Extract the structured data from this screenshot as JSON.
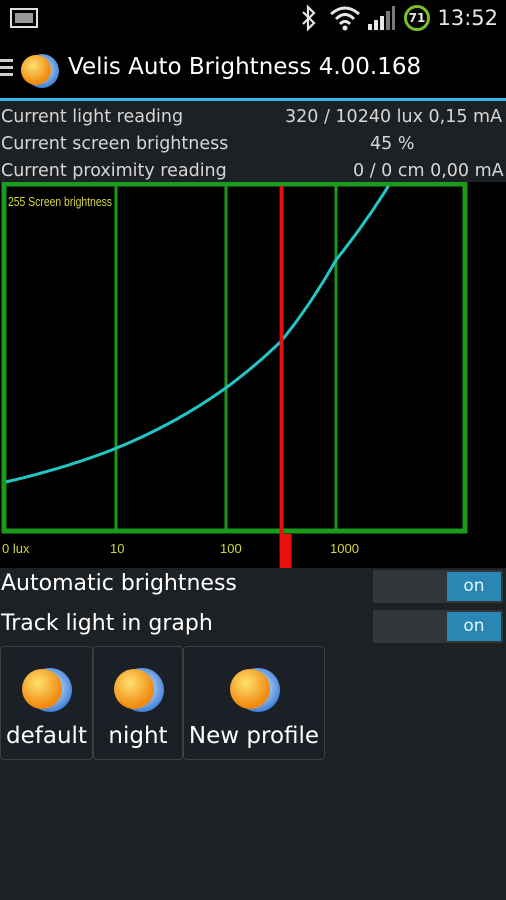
{
  "status_bar": {
    "time": "13:52",
    "battery_level": "71",
    "icons": [
      "image-icon",
      "bluetooth-icon",
      "wifi-icon",
      "signal-icon",
      "battery-icon"
    ]
  },
  "action_bar": {
    "title": "Velis Auto Brightness 4.00.168",
    "icons": [
      "menu-icon",
      "app-logo-icon"
    ]
  },
  "readings": [
    {
      "label": "Current light reading",
      "value": "320 / 10240 lux  0,15 mA"
    },
    {
      "label": "Current screen brightness",
      "value": "45 %"
    },
    {
      "label": "Current proximity reading",
      "value": "0 / 0 cm 0,00 mA"
    }
  ],
  "chart_data": {
    "type": "line",
    "title": "255 Screen brightness",
    "x_scale": "log",
    "x_tick_labels": [
      "0 lux",
      "10",
      "100",
      "1000"
    ],
    "x": [
      1,
      10,
      100,
      320,
      1000,
      3000
    ],
    "series": [
      {
        "values": [
          35,
          60,
          105,
          140,
          200,
          255
        ]
      }
    ],
    "ylim": [
      0,
      255
    ],
    "current_light_lux": 320,
    "current_brightness_percent": 45,
    "grid": true,
    "colors": {
      "frame": "#1b9a1b",
      "curve": "#22c6c6",
      "marker": "#e80f0f",
      "label": "#d6d63a"
    }
  },
  "toggles": [
    {
      "label": "Automatic brightness",
      "state": "on"
    },
    {
      "label": "Track light in graph",
      "state": "on"
    }
  ],
  "profiles": [
    {
      "name": "default",
      "icon": "profile-logo-icon"
    },
    {
      "name": "night",
      "icon": "profile-logo-icon"
    },
    {
      "name": "New profile",
      "icon": "profile-logo-icon"
    }
  ]
}
